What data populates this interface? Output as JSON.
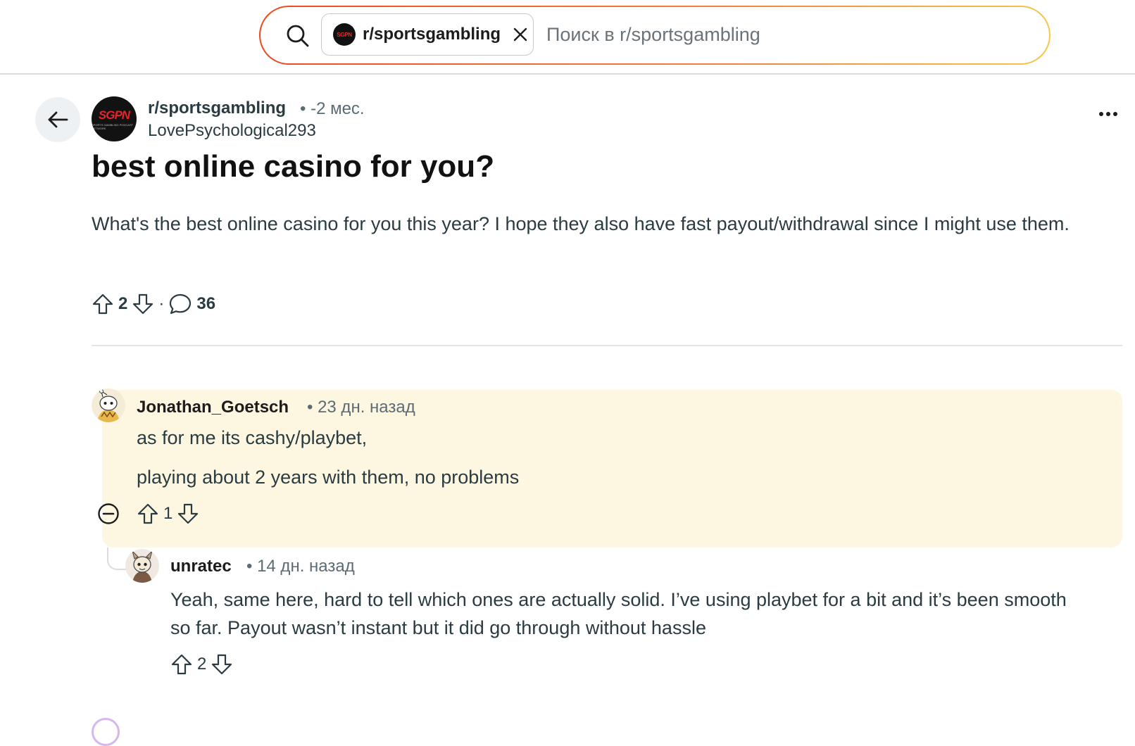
{
  "search": {
    "chip_label": "r/sportsgambling",
    "chip_avatar_text": "SGPN",
    "placeholder": "Поиск в r/sportsgambling"
  },
  "post": {
    "subreddit": "r/sportsgambling",
    "time": "• -2 мес.",
    "author": "LovePsychological293",
    "avatar_logo": "SGPN",
    "avatar_logo_sub": "SPORTS GAMBLING PODCAST NETWORK",
    "title": "best online casino for you?",
    "body": "What's the best online casino for you this year? I hope they also have fast payout/withdrawal since I might use them.",
    "score": "2",
    "separator": "·",
    "comments": "36"
  },
  "comments": [
    {
      "author": "Jonathan_Goetsch",
      "time": "• 23 дн. назад",
      "lines": [
        "as for me its cashy/playbet,",
        "playing about 2 years with them, no problems"
      ],
      "score": "1"
    },
    {
      "author": "unratec",
      "time": "• 14 дн. назад",
      "lines": [
        "Yeah, same here, hard to tell which ones are actually solid. I’ve using playbet for a bit and it’s been smooth so far. Payout wasn’t instant but it did go through without hassle"
      ],
      "score": "2"
    }
  ],
  "colors": {
    "search_gradient": [
      "#ee4a1f",
      "#f6c64d"
    ],
    "highlight": "#fdf7e1",
    "text": "#2a3c42",
    "muted": "#5c6c74"
  }
}
